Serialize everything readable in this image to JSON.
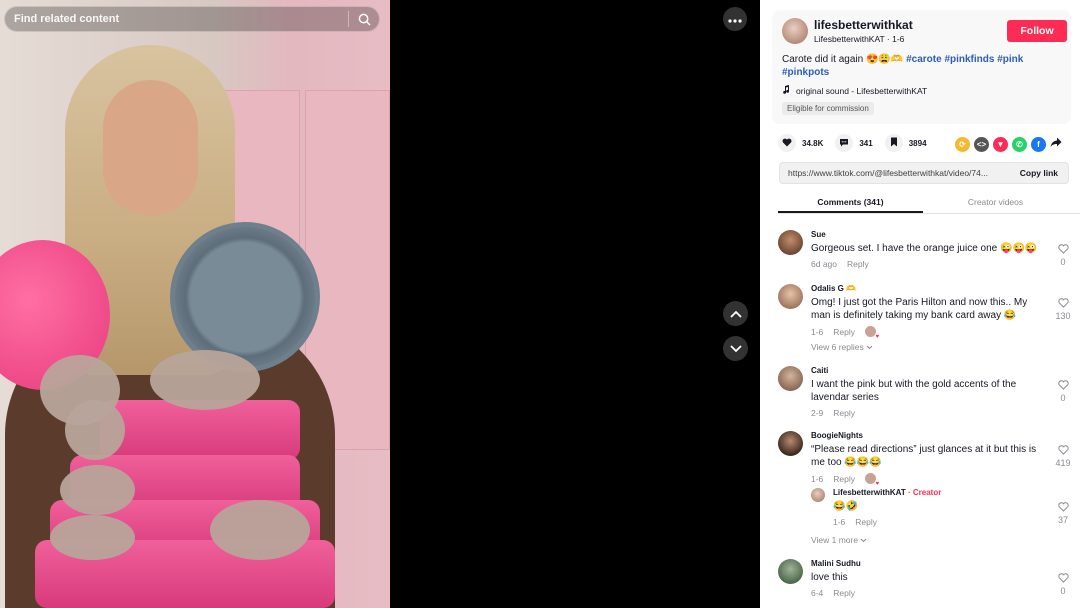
{
  "video": {
    "search_placeholder": "Find related content"
  },
  "author": {
    "username": "lifesbetterwithkat",
    "nickname_date": "LifesbetterwithKAT · 1-6",
    "follow_label": "Follow"
  },
  "post": {
    "caption_text": "Carote did it again 😍😩🫶",
    "hashtags": [
      "#carote",
      "#pinkfinds",
      "#pink",
      "#pinkpots"
    ],
    "sound": "original sound - LifesbetterwithKAT",
    "badge": "Eligible for commission"
  },
  "stats": {
    "likes": "34.8K",
    "comments": "341",
    "saves": "3894"
  },
  "link": {
    "url": "https://www.tiktok.com/@lifesbetterwithkat/video/74...",
    "copy_label": "Copy link"
  },
  "tabs": {
    "comments": "Comments (341)",
    "creator_videos": "Creator videos"
  },
  "comments": [
    {
      "name": "Sue",
      "text": "Gorgeous set. I have the orange juice one 😜😜😜",
      "date": "6d ago",
      "reply": "Reply",
      "likes": "0"
    },
    {
      "name": "Odalis G 🫶",
      "text": "Omg! I just got the Paris Hilton and now this.. My man is definitely taking my bank card away 😂",
      "date": "1-6",
      "reply": "Reply",
      "likes": "130",
      "view_replies": "View 6 replies"
    },
    {
      "name": "Caiti",
      "text": "I want the pink but with the gold accents of the lavendar series",
      "date": "2-9",
      "reply": "Reply",
      "likes": "0"
    },
    {
      "name": "BoogieNights",
      "text": "“Please read directions” just glances at it but this is me too 😂😂😂",
      "date": "1-6",
      "reply": "Reply",
      "likes": "419"
    },
    {
      "name": "Malini Sudhu",
      "text": "love this",
      "date": "6-4",
      "reply": "Reply",
      "likes": "0"
    }
  ],
  "creator_reply": {
    "name": "LifesbetterwithKAT",
    "separator": " · ",
    "badge": "Creator",
    "text": "😂🤣",
    "date": "1-6",
    "reply": "Reply",
    "likes": "37",
    "view_more": "View 1 more"
  },
  "colors": {
    "follow": "#fe2c55",
    "hashtag": "#2b5db9",
    "creator": "#fe2c55"
  },
  "icons": [
    "search-icon",
    "more-icon",
    "chevron-up-icon",
    "chevron-down-icon",
    "music-note-icon",
    "heart-icon",
    "comment-icon",
    "bookmark-icon",
    "share-arrow-icon"
  ]
}
